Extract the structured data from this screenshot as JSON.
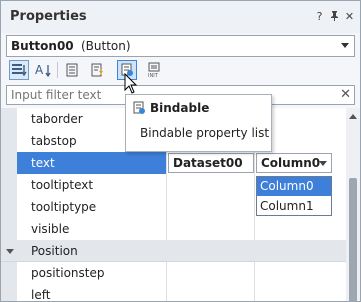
{
  "panel": {
    "title": "Properties",
    "help_glyph": "?",
    "pin_glyph": "✦",
    "close_glyph": "✕"
  },
  "object_selector": {
    "name": "Button00",
    "type": "(Button)"
  },
  "toolbar": {
    "tools": [
      "category-sort",
      "alpha-sort",
      "properties",
      "events",
      "bindable",
      "init"
    ],
    "active_tool": "bindable"
  },
  "filter": {
    "placeholder": "Input filter text",
    "clear_glyph": "✕"
  },
  "tooltip": {
    "title": "Bindable",
    "description": "Bindable property list"
  },
  "grid": {
    "rows": [
      {
        "label": "taborder"
      },
      {
        "label": "tabstop"
      },
      {
        "label": "text",
        "selected": true,
        "dataset": "Dataset00",
        "column": "Column0"
      },
      {
        "label": "tooltiptext"
      },
      {
        "label": "tooltiptype"
      },
      {
        "label": "visible"
      }
    ],
    "group": {
      "label": "Position"
    },
    "group_rows": [
      {
        "label": "positionstep"
      },
      {
        "label": "left"
      }
    ]
  },
  "dropdown": {
    "options": [
      "Column0",
      "Column1"
    ],
    "selected": "Column0"
  },
  "colors": {
    "selection": "#3d7fd9",
    "gutter": "#e3e7ec",
    "accent": "#3a86d6"
  }
}
